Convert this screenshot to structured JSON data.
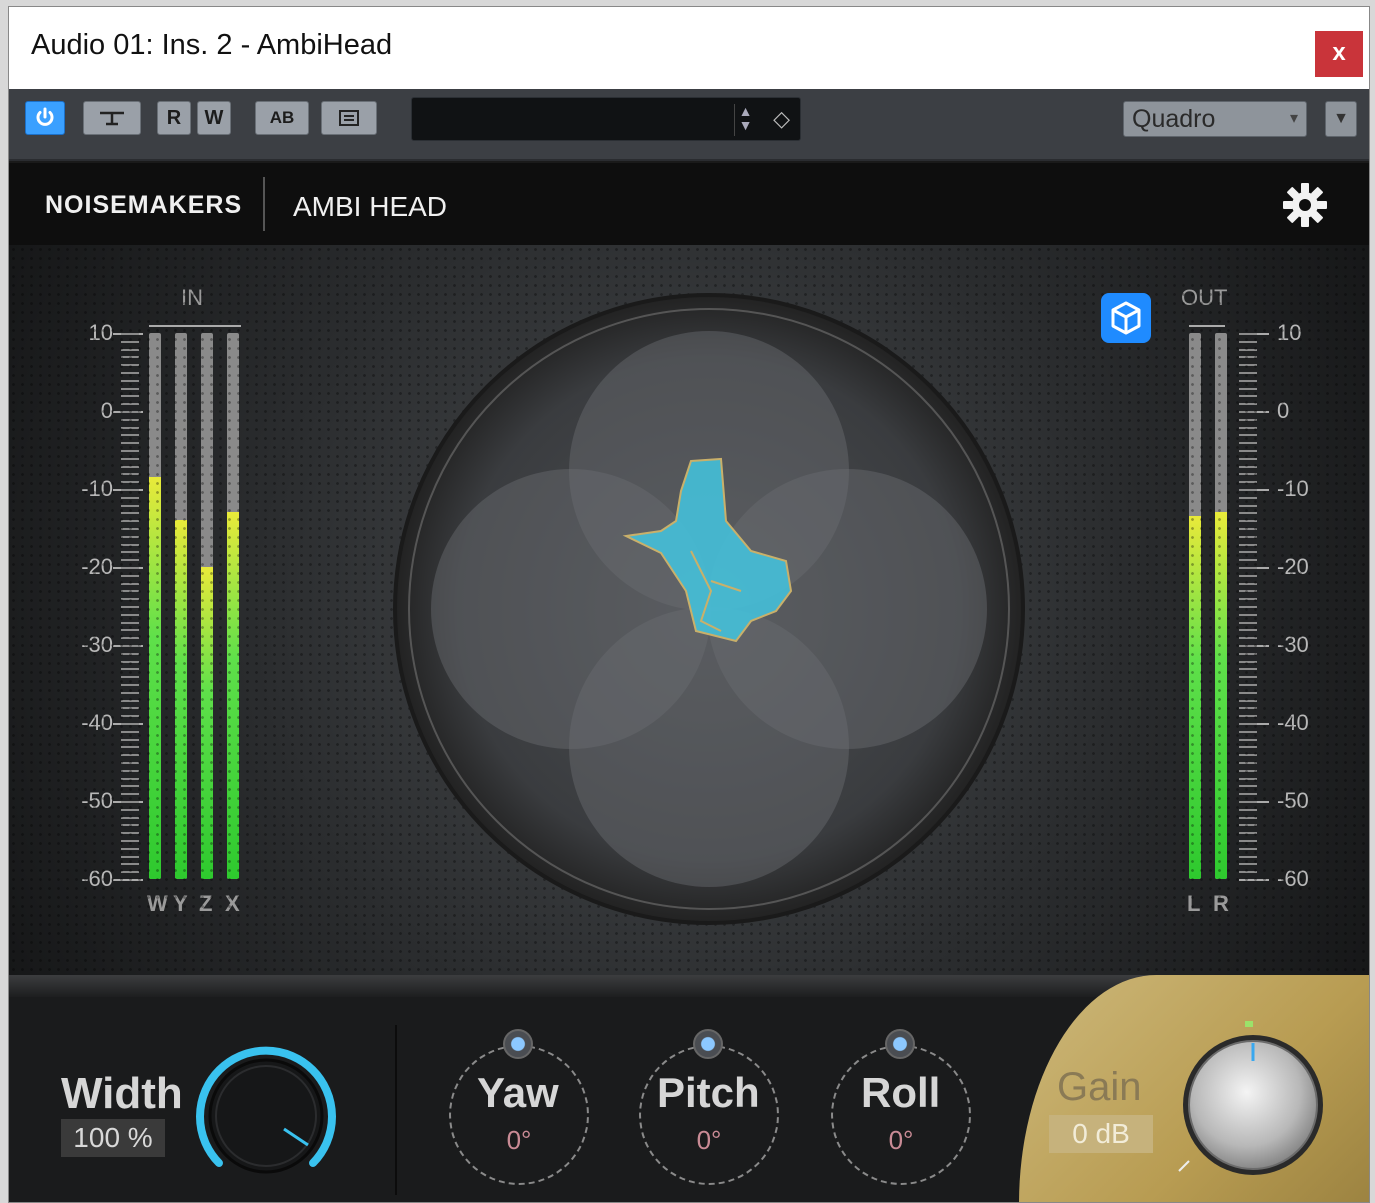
{
  "window": {
    "title": "Audio 01: Ins. 2 - AmbiHead",
    "close_label": "x"
  },
  "toolbar": {
    "power_icon": "power-icon",
    "bypass_icon": "bypass-icon",
    "read_label": "R",
    "write_label": "W",
    "ab_label": "AB",
    "menu_icon": "list-icon",
    "preset_value": "",
    "output_format": "Quadro"
  },
  "header": {
    "brand": "NOISEMAKERS",
    "product": "AMBI HEAD"
  },
  "meters": {
    "scale": [
      "10",
      "0",
      "-10",
      "-20",
      "-30",
      "-40",
      "-50",
      "-60"
    ],
    "in_label": "IN",
    "out_label": "OUT",
    "in_channels": [
      {
        "name": "W",
        "level_db": -8.5
      },
      {
        "name": "Y",
        "level_db": -14
      },
      {
        "name": "Z",
        "level_db": -20
      },
      {
        "name": "X",
        "level_db": -13
      }
    ],
    "out_channels": [
      {
        "name": "L",
        "level_db": -13.5
      },
      {
        "name": "R",
        "level_db": -13
      }
    ]
  },
  "controls": {
    "width": {
      "label": "Width",
      "value": "100 %"
    },
    "yaw": {
      "label": "Yaw",
      "value": "0°"
    },
    "pitch": {
      "label": "Pitch",
      "value": "0°"
    },
    "roll": {
      "label": "Roll",
      "value": "0°"
    },
    "gain": {
      "label": "Gain",
      "value": "0 dB"
    }
  },
  "colors": {
    "accent_blue": "#1f8bff",
    "meter_green": "#2ec92e",
    "meter_yellow": "#e9ea3a",
    "gain_gold": "#c4ab6a"
  }
}
